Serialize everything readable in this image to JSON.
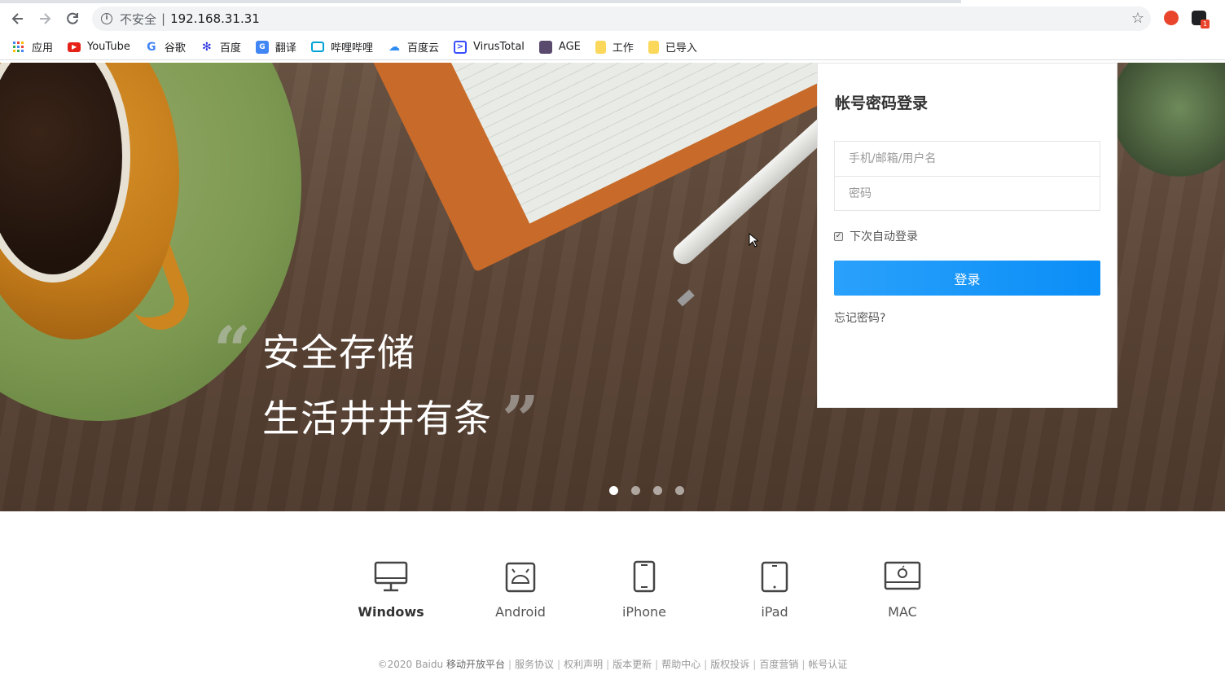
{
  "browser": {
    "insecure_label": "不安全",
    "url": "192.168.31.31",
    "bookmarks": [
      {
        "label": "应用",
        "icon": "apps-grid-icon"
      },
      {
        "label": "YouTube",
        "icon": "youtube-icon"
      },
      {
        "label": "谷歌",
        "icon": "google-icon"
      },
      {
        "label": "百度",
        "icon": "baidu-paw-icon"
      },
      {
        "label": "翻译",
        "icon": "translate-icon"
      },
      {
        "label": "哔哩哔哩",
        "icon": "bilibili-tv-icon"
      },
      {
        "label": "百度云",
        "icon": "baidu-cloud-icon"
      },
      {
        "label": "VirusTotal",
        "icon": "virustotal-icon"
      },
      {
        "label": "AGE",
        "icon": "age-avatar-icon"
      },
      {
        "label": "工作",
        "icon": "folder-icon"
      },
      {
        "label": "已导入",
        "icon": "folder-icon"
      }
    ],
    "extension_badge": "1"
  },
  "hero": {
    "line1": "安全存储",
    "line2": "生活井井有条",
    "quote_open": "“",
    "quote_close": "”",
    "slides": 4,
    "active_slide": 0
  },
  "login": {
    "title": "帐号密码登录",
    "username_placeholder": "手机/邮箱/用户名",
    "password_placeholder": "密码",
    "remember_label": "下次自动登录",
    "remember_checked": true,
    "submit_label": "登录",
    "forgot_label": "忘记密码?"
  },
  "platforms": [
    {
      "label": "Windows",
      "icon": "monitor-icon"
    },
    {
      "label": "Android",
      "icon": "android-icon"
    },
    {
      "label": "iPhone",
      "icon": "iphone-icon"
    },
    {
      "label": "iPad",
      "icon": "ipad-icon"
    },
    {
      "label": "MAC",
      "icon": "apple-monitor-icon"
    }
  ],
  "footer": {
    "copyright": "©2020 Baidu",
    "links": [
      "移动开放平台",
      "服务协议",
      "权利声明",
      "版本更新",
      "帮助中心",
      "版权投诉",
      "百度营销",
      "帐号认证"
    ]
  },
  "colors": {
    "accent": "#1a98fa",
    "text": "#333333",
    "muted": "#999999"
  }
}
